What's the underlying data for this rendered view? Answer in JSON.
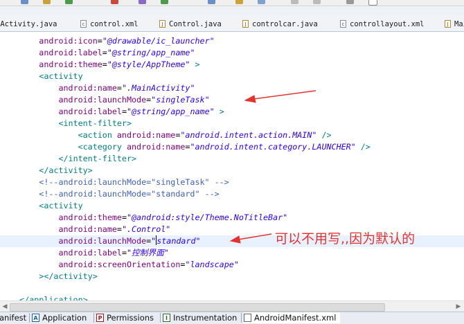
{
  "tabs": [
    {
      "label": "nActivity.java",
      "kind": "java"
    },
    {
      "label": "control.xml",
      "kind": "xml"
    },
    {
      "label": "Control.java",
      "kind": "java"
    },
    {
      "label": "controlcar.java",
      "kind": "java"
    },
    {
      "label": "controllayout.xml",
      "kind": "xml"
    },
    {
      "label": "Mai",
      "kind": "java"
    }
  ],
  "code": {
    "l1": {
      "attr": "android:icon",
      "val": "\"@drawable/ic_launcher\""
    },
    "l2": {
      "attr": "android:label",
      "val": "\"@string/app_name\""
    },
    "l3": {
      "attr": "android:theme",
      "val": "\"@style/AppTheme\"",
      "close": " >"
    },
    "l4": {
      "tag": "<activity"
    },
    "l5": {
      "attr": "android:name",
      "val": "\".MainActivity\""
    },
    "l6": {
      "attr": "android:launchMode",
      "val": "\"singleTask\""
    },
    "l7": {
      "attr": "android:label",
      "val": "\"@string/app_name\"",
      "close": " >"
    },
    "l8": {
      "tag": "<intent-filter>"
    },
    "l9": {
      "tag": "<action ",
      "attr": "android:name",
      "val": "\"android.intent.action.MAIN\"",
      "close": " />"
    },
    "l10": {
      "tag": "<category ",
      "attr": "android:name",
      "val": "\"android.intent.category.LAUNCHER\"",
      "close": " />"
    },
    "l11": {
      "tag": "</intent-filter>"
    },
    "l12": {
      "tag": "</activity>"
    },
    "l13": {
      "comment": "<!--android:launchMode=\"singleTask\" -->"
    },
    "l14": {
      "comment": "<!--android:launchMode=\"standard\" -->"
    },
    "l15": {
      "tag": "<activity"
    },
    "l16": {
      "attr": "android:theme",
      "val": "\"@android:style/Theme.NoTitleBar\""
    },
    "l17": {
      "attr": "android:name",
      "val": "\".Control\""
    },
    "l18": {
      "attr": "android:launchMode",
      "val_a": "\"",
      "val_b": "standard\""
    },
    "l19": {
      "attr": "android:label",
      "val": "\"控制界面\""
    },
    "l20": {
      "attr": "android:screenOrientation",
      "val": "\"landscape\""
    },
    "l21": {
      "tag": "></activity>"
    },
    "l22": {
      "tag": "</application>"
    }
  },
  "annotation": "可以不用写,,因为默认的",
  "bottom_tabs": [
    {
      "icon": "",
      "label": "anifest"
    },
    {
      "icon": "A",
      "label": "Application"
    },
    {
      "icon": "P",
      "label": "Permissions"
    },
    {
      "icon": "I",
      "label": "Instrumentation"
    },
    {
      "icon": "",
      "label": "AndroidManifest.xml"
    }
  ],
  "colors": {
    "annotation_red": "#e5322d",
    "attr": "#7f007f",
    "value": "#2a00ff",
    "tag": "#008080",
    "comment": "#3f5fbf"
  }
}
